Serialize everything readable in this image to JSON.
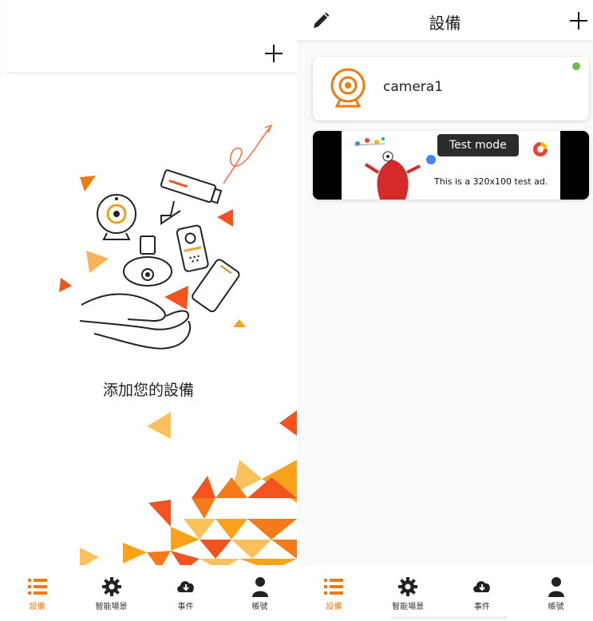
{
  "left_screen": {
    "empty_state": {
      "message": "添加您的設備"
    }
  },
  "right_screen": {
    "header": {
      "title": "設備"
    },
    "devices": [
      {
        "name": "camera1",
        "status": "online",
        "status_color": "#6cc04a"
      }
    ],
    "ad": {
      "badge": "Test mode",
      "text": "This is a 320x100 test ad."
    }
  },
  "bottom_nav": {
    "items": [
      {
        "label": "設備",
        "icon": "list-icon",
        "active": true
      },
      {
        "label": "智能場景",
        "icon": "gear-icon",
        "active": false
      },
      {
        "label": "事件",
        "icon": "cloud-download-icon",
        "active": false
      },
      {
        "label": "帳號",
        "icon": "user-icon",
        "active": false
      }
    ]
  },
  "colors": {
    "accent": "#f07a12",
    "online": "#6cc04a"
  }
}
